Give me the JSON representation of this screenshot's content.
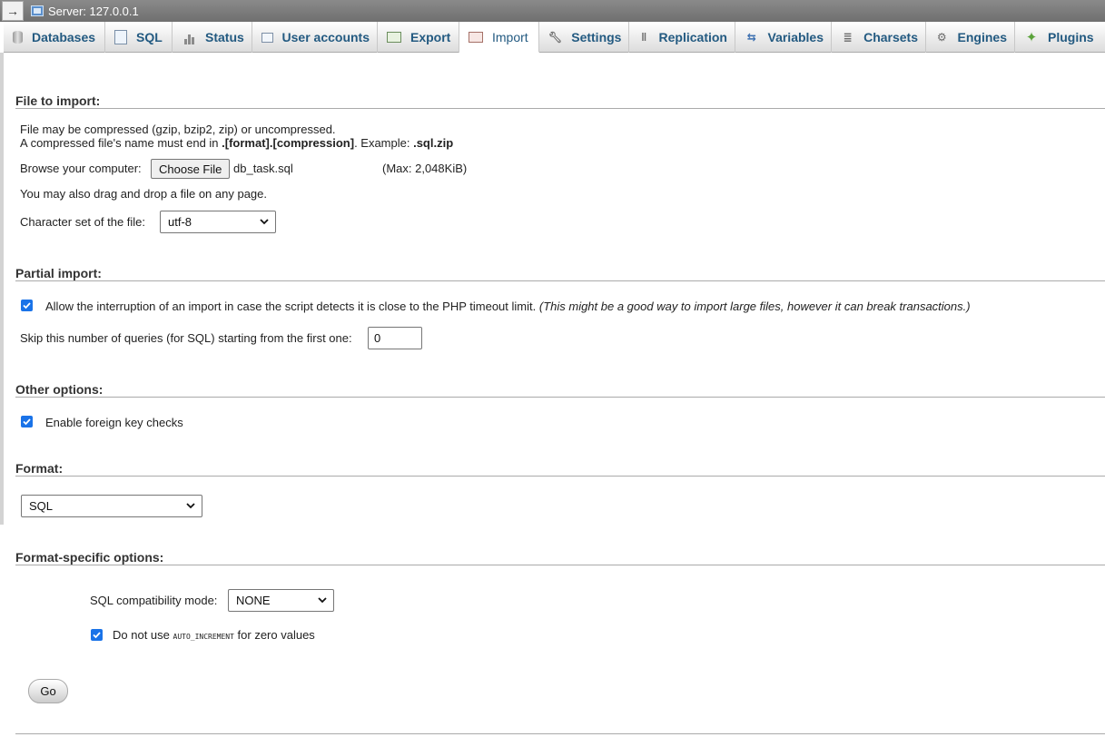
{
  "server_bar": {
    "collapse_glyph": "→",
    "label": "Server: 127.0.0.1"
  },
  "tabs": [
    {
      "label": "Databases",
      "icon": "database-icon"
    },
    {
      "label": "SQL",
      "icon": "sql-icon"
    },
    {
      "label": "Status",
      "icon": "status-icon"
    },
    {
      "label": "User accounts",
      "icon": "user-accounts-icon"
    },
    {
      "label": "Export",
      "icon": "export-icon"
    },
    {
      "label": "Import",
      "icon": "import-icon",
      "active": true
    },
    {
      "label": "Settings",
      "icon": "wrench-icon"
    },
    {
      "label": "Replication",
      "icon": "replication-icon"
    },
    {
      "label": "Variables",
      "icon": "variables-icon"
    },
    {
      "label": "Charsets",
      "icon": "charsets-icon"
    },
    {
      "label": "Engines",
      "icon": "engines-icon"
    },
    {
      "label": "Plugins",
      "icon": "plugin-icon"
    }
  ],
  "file_to_import": {
    "title": "File to import:",
    "line1": "File may be compressed (gzip, bzip2, zip) or uncompressed.",
    "line2_prefix": "A compressed file's name must end in ",
    "line2_bold": ".[format].[compression]",
    "line2_mid": ". Example: ",
    "line2_example": ".sql.zip",
    "browse_label": "Browse your computer:",
    "choose_file_label": "Choose File",
    "chosen_file": "db_task.sql",
    "max_size": "(Max: 2,048KiB)",
    "drag_drop_note": "You may also drag and drop a file on any page.",
    "charset_label": "Character set of the file:",
    "charset_value": "utf-8"
  },
  "partial_import": {
    "title": "Partial import:",
    "allow_interrupt_label": "Allow the interruption of an import in case the script detects it is close to the PHP timeout limit.",
    "allow_interrupt_note": "(This might be a good way to import large files, however it can break transactions.)",
    "allow_interrupt_checked": true,
    "skip_label": "Skip this number of queries (for SQL) starting from the first one:",
    "skip_value": "0"
  },
  "other_options": {
    "title": "Other options:",
    "foreign_key_label": "Enable foreign key checks",
    "foreign_key_checked": true
  },
  "format": {
    "title": "Format:",
    "value": "SQL"
  },
  "format_specific": {
    "title": "Format-specific options:",
    "compat_label": "SQL compatibility mode:",
    "compat_value": "NONE",
    "auto_inc_prefix": "Do not use ",
    "auto_inc_code": "AUTO_INCREMENT",
    "auto_inc_suffix": " for zero values",
    "auto_inc_checked": true
  },
  "go_button": "Go",
  "colors": {
    "tab_text": "#235a81",
    "checkbox": "#1a73e8",
    "server_bar": "#777777"
  }
}
